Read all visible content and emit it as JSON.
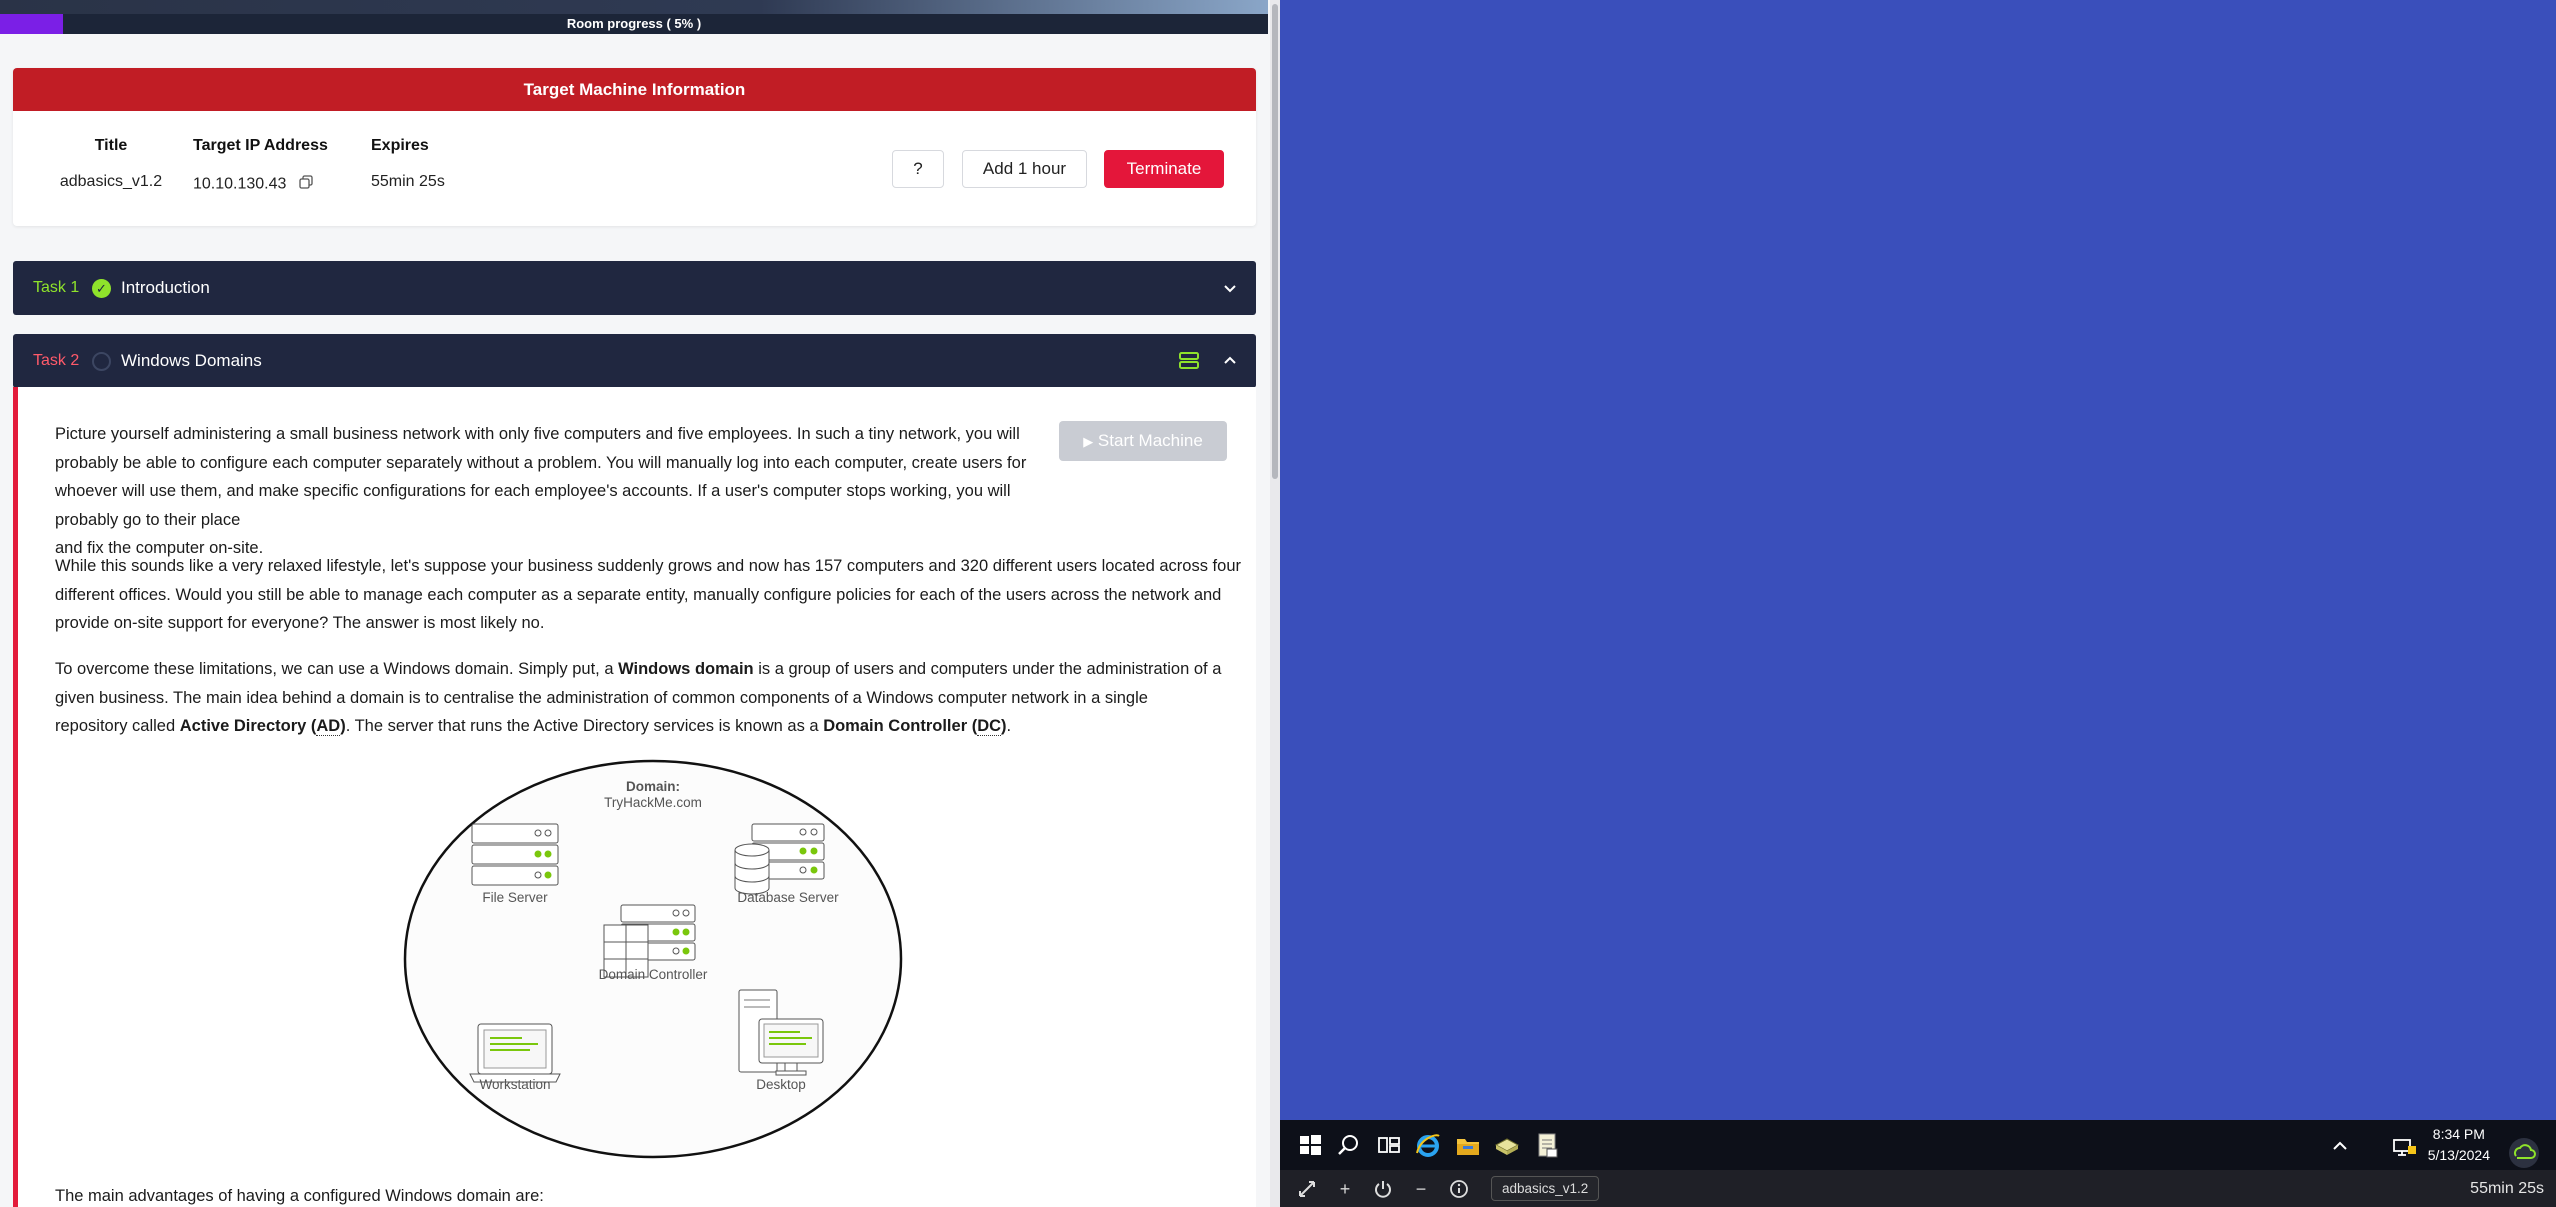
{
  "progress": {
    "label": "Room progress ( 5% )",
    "percent": 5
  },
  "target_machine": {
    "header": "Target Machine Information",
    "columns": [
      {
        "label": "Title",
        "value": "adbasics_v1.2"
      },
      {
        "label": "Target IP Address",
        "value": "10.10.130.43"
      },
      {
        "label": "Expires",
        "value": "55min 25s"
      }
    ],
    "help_label": "?",
    "add_hour_label": "Add 1 hour",
    "terminate_label": "Terminate"
  },
  "tasks": [
    {
      "number": "Task 1",
      "title": "Introduction",
      "completed": true
    },
    {
      "number": "Task 2",
      "title": "Windows Domains",
      "completed": false
    }
  ],
  "task2": {
    "start_machine_label": "Start Machine",
    "p1": [
      "Picture yourself administering a small business network with only five computers and five employees. In such a tiny network, you will",
      "probably be able to configure each computer separately without a problem. You will manually log into each computer, create users for",
      "whoever will use them, and make specific configurations for each employee's accounts. If a user's computer stops working, you will probably go to their place",
      "and fix the computer on-site."
    ],
    "p2": [
      "While this sounds like a very relaxed lifestyle, let's suppose your business suddenly grows and now has 157 computers and 320 different users located across four",
      "different offices. Would you still be able to manage each computer as a separate entity, manually configure policies for each of the users across the network and",
      "provide on-site support for everyone? The answer is most likely no."
    ],
    "p3": {
      "l1_a": "To overcome these limitations, we can use a Windows domain. Simply put, a ",
      "l1_b": "Windows domain",
      "l1_c": " is a group of users and computers under the administration of a",
      "l2": "given business. The main idea behind a domain is to centralise the administration of common components of a Windows computer network in a single",
      "l3_a": "repository called ",
      "l3_b": "Active Directory (",
      "l3_c": "AD",
      "l3_d": ")",
      "l3_e": ". The server that runs the Active Directory services is known as a ",
      "l3_f": "Domain Controller (",
      "l3_g": "DC",
      "l3_h": ")",
      "l3_i": "."
    },
    "p4": "The main advantages of having a configured Windows domain are:",
    "diagram": {
      "domain_label": "Domain:",
      "domain_name": "TryHackMe.com",
      "file_server": "File Server",
      "database_server": "Database Server",
      "domain_controller": "Domain Controller",
      "workstation": "Workstation",
      "desktop": "Desktop"
    }
  },
  "vm": {
    "clock_time": "8:34 PM",
    "clock_date": "5/13/2024",
    "machine_name": "adbasics_v1.2",
    "timer": "55min 25s",
    "desktop_color": "#3a4fbb",
    "taskbar_icons": [
      "windows-start-icon",
      "search-icon",
      "task-view-icon",
      "internet-explorer-icon",
      "file-explorer-icon",
      "server-manager-icon",
      "notepad-icon"
    ]
  },
  "colors": {
    "accent_red": "#c11d25",
    "task_bar": "#202740",
    "success_green": "#8fe32b",
    "terminate_red": "#e4163a"
  }
}
